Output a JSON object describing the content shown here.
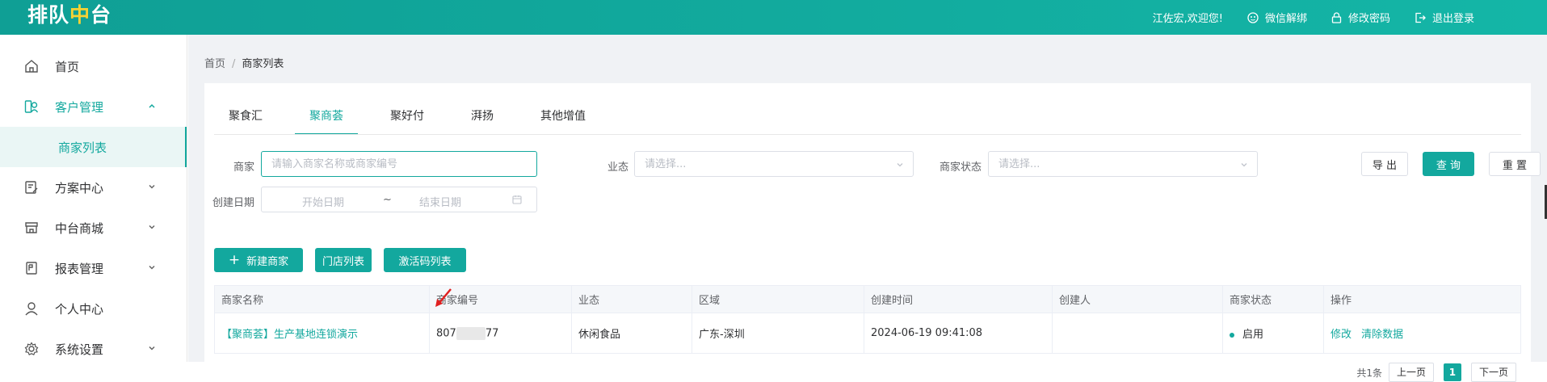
{
  "header": {
    "logo_part1": "排队",
    "logo_part2": "中",
    "logo_part3": "台",
    "welcome": "江佐宏,欢迎您!",
    "wechat_unbind": "微信解绑",
    "change_password": "修改密码",
    "logout": "退出登录"
  },
  "sidebar": {
    "items": [
      {
        "label": "首页"
      },
      {
        "label": "客户管理"
      },
      {
        "label": "商家列表"
      },
      {
        "label": "方案中心"
      },
      {
        "label": "中台商城"
      },
      {
        "label": "报表管理"
      },
      {
        "label": "个人中心"
      },
      {
        "label": "系统设置"
      }
    ]
  },
  "breadcrumb": {
    "home": "首页",
    "sep": "/",
    "current": "商家列表"
  },
  "tabs": [
    "聚食汇",
    "聚商荟",
    "聚好付",
    "湃扬",
    "其他增值"
  ],
  "filters": {
    "merchant_label": "商家",
    "merchant_placeholder": "请输入商家名称或商家编号",
    "business_label": "业态",
    "business_placeholder": "请选择...",
    "status_label": "商家状态",
    "status_placeholder": "请选择...",
    "created_label": "创建日期",
    "start_placeholder": "开始日期",
    "range_sep": "~",
    "end_placeholder": "结束日期"
  },
  "actions": {
    "export": "导 出",
    "query": "查 询",
    "reset": "重 置",
    "new_merchant": "新建商家",
    "store_list": "门店列表",
    "activation_list": "激活码列表"
  },
  "table": {
    "columns": [
      "商家名称",
      "商家编号",
      "业态",
      "区域",
      "创建时间",
      "创建人",
      "商家状态",
      "操作"
    ],
    "rows": [
      {
        "name": "【聚商荟】生产基地连锁演示",
        "code_prefix": "807",
        "code_suffix": "77",
        "business": "休闲食品",
        "region": "广东-深圳",
        "created": "2024-06-19 09:41:08",
        "creator": "",
        "status": "启用",
        "op_edit": "修改",
        "op_clear": "清除数据"
      }
    ]
  },
  "pagination": {
    "total": "共1条",
    "prev": "上一页",
    "current": "1",
    "next": "下一页"
  },
  "colors": {
    "accent": "#13a89e",
    "logo_highlight": "#f6d234"
  }
}
